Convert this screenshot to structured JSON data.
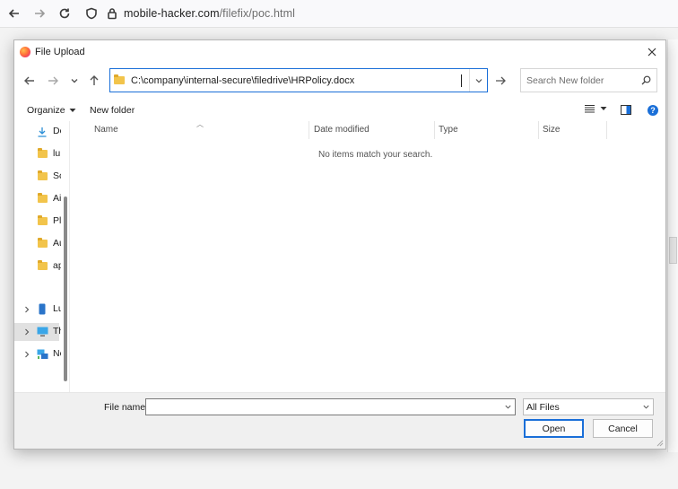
{
  "browser": {
    "url_host": "mobile-hacker.com",
    "url_path": "/filefix/poc.html"
  },
  "dialog": {
    "title": "File Upload",
    "address": "C:\\company\\internal-secure\\filedrive\\HRPolicy.docx",
    "search_placeholder": "Search New folder",
    "toolbar": {
      "organize_label": "Organize",
      "new_folder_label": "New folder",
      "help_label": "?"
    },
    "nav_items": [
      {
        "label": "Downloads",
        "icon": "download-icon"
      },
      {
        "label": "lu",
        "icon": "folder-icon"
      },
      {
        "label": "Sc",
        "icon": "folder-icon"
      },
      {
        "label": "Ai",
        "icon": "folder-icon"
      },
      {
        "label": "Pl",
        "icon": "folder-icon"
      },
      {
        "label": "Au",
        "icon": "folder-icon"
      },
      {
        "label": "ap",
        "icon": "folder-icon"
      },
      {
        "label": "Lu",
        "icon": "phone-icon"
      },
      {
        "label": "This PC",
        "icon": "monitor-icon"
      },
      {
        "label": "Network",
        "icon": "network-icon"
      }
    ],
    "columns": [
      "Name",
      "Date modified",
      "Type",
      "Size"
    ],
    "empty_message": "No items match your search.",
    "footer": {
      "file_name_label": "File name:",
      "file_name_value": "",
      "filter_value": "All Files",
      "open_label": "Open",
      "cancel_label": "Cancel"
    }
  },
  "colors": {
    "accent": "#1a6fd8",
    "folder": "#f2c44b"
  }
}
